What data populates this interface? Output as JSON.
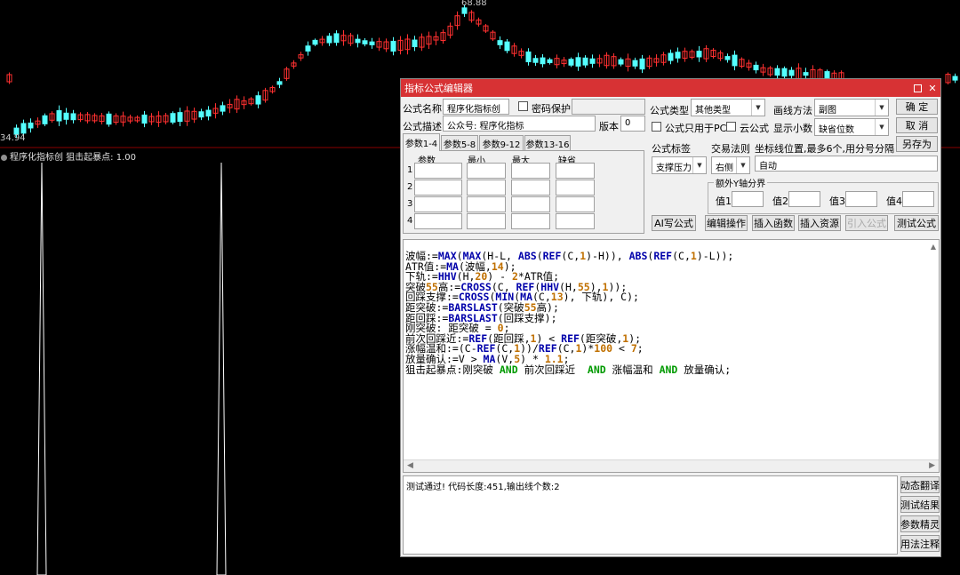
{
  "chart": {
    "price_high_label": "68.88",
    "price_low_label": "34.94",
    "indicator_title": "程序化指标创  狙击起暴点: 1.00",
    "colors": {
      "up": "#ff3030",
      "down": "#54ffff",
      "signal": "#ffffff",
      "divider": "#8a0000"
    }
  },
  "editor": {
    "title": "指标公式编辑器",
    "labels": {
      "formula_name": "公式名称",
      "password": "密码保护",
      "formula_desc": "公式描述",
      "version": "版本",
      "formula_type": "公式类型",
      "draw_method": "画线方法",
      "pc_only": "公式只用于PC",
      "cloud": "云公式",
      "decimals": "显示小数",
      "formula_tag": "公式标签",
      "trade_rule": "交易法则",
      "coord_pos": "坐标线位置,最多6个,用分号分隔",
      "extra_y": "额外Y轴分界",
      "v1": "值1",
      "v2": "值2",
      "v3": "值3",
      "v4": "值4"
    },
    "values": {
      "formula_name": "程序化指标创",
      "formula_desc": "公众号: 程序化指标",
      "version": "0",
      "formula_type": "其他类型",
      "draw_method": "副图",
      "decimals": "缺省位数",
      "formula_tag": "支撑压力",
      "trade_rule": "右侧",
      "coord_pos": "自动"
    },
    "buttons": {
      "ok": "确  定",
      "cancel": "取  消",
      "save_as": "另存为",
      "ai_write": "AI写公式",
      "edit_op": "编辑操作",
      "insert_func": "插入函数",
      "insert_res": "插入资源",
      "import_formula": "引入公式",
      "test_formula": "测试公式",
      "dynamic_translate": "动态翻译",
      "test_result": "测试结果",
      "param_wizard": "参数精灵",
      "usage_note": "用法注释"
    },
    "tabs": [
      "参数1-4",
      "参数5-8",
      "参数9-12",
      "参数13-16"
    ],
    "param_headers": [
      "参数",
      "最小",
      "最大",
      "缺省"
    ],
    "param_rows": [
      "1",
      "2",
      "3",
      "4"
    ],
    "code_lines": [
      "波幅:=MAX(MAX(H-L, ABS(REF(C,1)-H)), ABS(REF(C,1)-L));",
      "ATR值:=MA(波幅,14);",
      "下轨:=HHV(H,20) - 2*ATR值;",
      "突破55高:=CROSS(C, REF(HHV(H,55),1));",
      "回踩支撑:=CROSS(MIN(MA(C,13), 下轨), C);",
      "距突破:=BARSLAST(突破55高);",
      "距回踩:=BARSLAST(回踩支撑);",
      "刚突破: 距突破 = 0;",
      "前次回踩近:=REF(距回踩,1) < REF(距突破,1);",
      "涨幅温和:=(C-REF(C,1))/REF(C,1)*100 < 7;",
      "放量确认:=V > MA(V,5) * 1.1;",
      "狙击起暴点:刚突破 AND 前次回踩近  AND 涨幅温和 AND 放量确认;"
    ],
    "status": "测试通过! 代码长度:451,输出线个数:2"
  }
}
